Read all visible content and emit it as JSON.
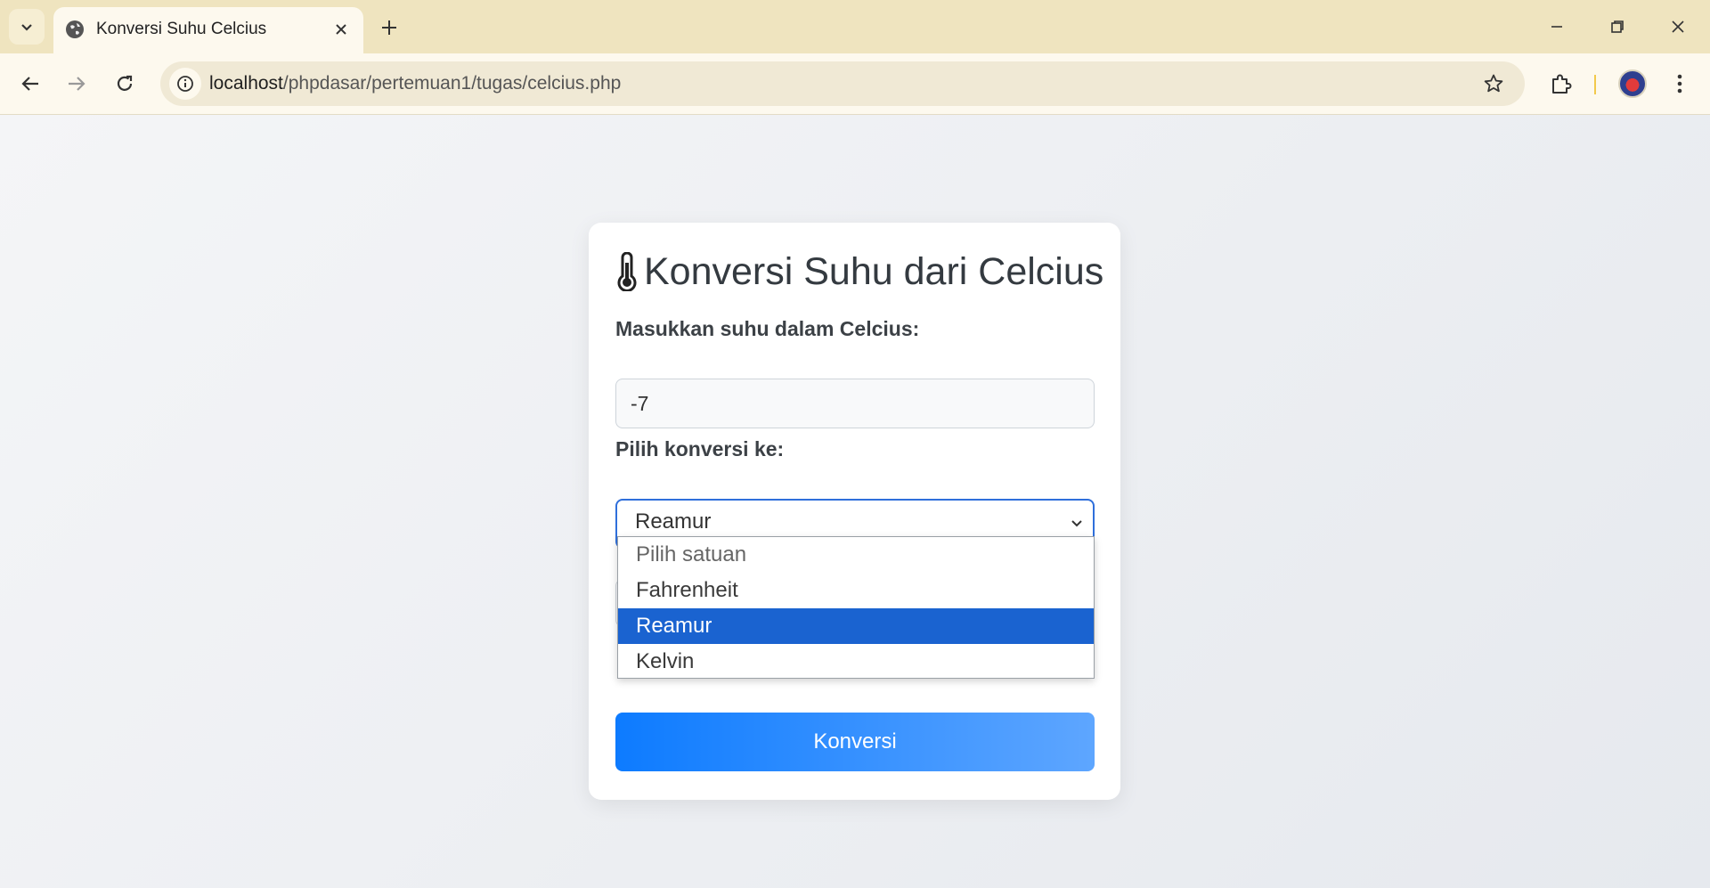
{
  "browser": {
    "tab_title": "Konversi Suhu Celcius",
    "url_host": "localhost",
    "url_path": "/phpdasar/pertemuan1/tugas/celcius.php"
  },
  "page": {
    "title": "Konversi Suhu dari Celcius",
    "title_icon": "thermometer-icon",
    "celsius_label": "Masukkan suhu dalam Celcius:",
    "celsius_value": "-7",
    "convert_label": "Pilih konversi ke:",
    "selected_unit": "Reamur",
    "options": [
      "Pilih satuan",
      "Fahrenheit",
      "Reamur",
      "Kelvin"
    ],
    "submit_label": "Konversi"
  },
  "colors": {
    "accent": "#0d7bff",
    "selected_option": "#1a63d0",
    "chrome_bg": "#efe4bf"
  }
}
